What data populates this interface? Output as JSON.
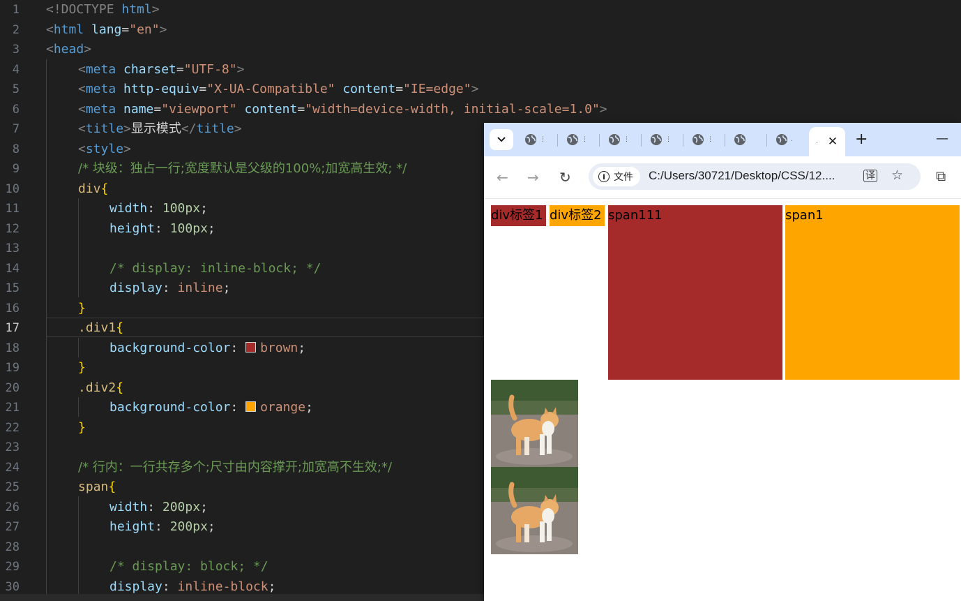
{
  "editor": {
    "active_line": "17",
    "line_numbers": [
      "1",
      "2",
      "3",
      "4",
      "5",
      "6",
      "7",
      "8",
      "9",
      "10",
      "11",
      "12",
      "13",
      "14",
      "15",
      "16",
      "17",
      "18",
      "19",
      "20",
      "21",
      "22",
      "23",
      "24",
      "25",
      "26",
      "27",
      "28",
      "29",
      "30"
    ],
    "code": {
      "l1a": "<!DOCTYPE",
      "l1b": " html",
      "l1c": ">",
      "l2a": "<",
      "l2b": "html",
      "l2c": " lang",
      "l2d": "=",
      "l2e": "\"en\"",
      "l2f": ">",
      "l3a": "<",
      "l3b": "head",
      "l3c": ">",
      "l4a": "<",
      "l4b": "meta",
      "l4c": " charset",
      "l4d": "=",
      "l4e": "\"UTF-8\"",
      "l4f": ">",
      "l5a": "<",
      "l5b": "meta",
      "l5c": " http-equiv",
      "l5d": "=",
      "l5e": "\"X-UA-Compatible\"",
      "l5f": " content",
      "l5g": "=",
      "l5h": "\"IE=edge\"",
      "l5i": ">",
      "l6a": "<",
      "l6b": "meta",
      "l6c": " name",
      "l6d": "=",
      "l6e": "\"viewport\"",
      "l6f": " content",
      "l6g": "=",
      "l6h": "\"width=device-width, initial-scale=1.0\"",
      "l6i": ">",
      "l7a": "<",
      "l7b": "title",
      "l7c": ">",
      "l7d": "显示模式",
      "l7e": "</",
      "l7f": "title",
      "l7g": ">",
      "l8a": "<",
      "l8b": "style",
      "l8c": ">",
      "l9": "/* 块级：独占一行;宽度默认是父级的100%;加宽高生效; */",
      "l10a": "div",
      "l10b": "{",
      "l11a": "width",
      "l11b": ": ",
      "l11c": "100px",
      "l11d": ";",
      "l12a": "height",
      "l12b": ": ",
      "l12c": "100px",
      "l12d": ";",
      "l14": "/* display: inline-block; */",
      "l15a": "display",
      "l15b": ": ",
      "l15c": "inline",
      "l15d": ";",
      "l16": "}",
      "l17a": ".div1",
      "l17b": "{",
      "l18a": "background-color",
      "l18b": ": ",
      "l18c": "brown",
      "l18d": ";",
      "l19": "}",
      "l20a": ".div2",
      "l20b": "{",
      "l21a": "background-color",
      "l21b": ": ",
      "l21c": "orange",
      "l21d": ";",
      "l22": "}",
      "l24": "/* 行内：一行共存多个;尺寸由内容撑开;加宽高不生效;*/",
      "l25a": "span",
      "l25b": "{",
      "l26a": "width",
      "l26b": ": ",
      "l26c": "200px",
      "l26d": ";",
      "l27a": "height",
      "l27b": ": ",
      "l27c": "200px",
      "l27d": ";",
      "l29": "/* display: block; */",
      "l30a": "display",
      "l30b": ": ",
      "l30c": "inline-block",
      "l30d": ";"
    },
    "swatches": {
      "brown": "#a52a2a",
      "orange": "#ffa500"
    }
  },
  "browser": {
    "tabs": [
      {
        "icon": "globe-icon",
        "label": "⋮"
      },
      {
        "icon": "globe-icon",
        "label": "⋮"
      },
      {
        "icon": "globe-icon",
        "label": "⋮"
      },
      {
        "icon": "globe-icon",
        "label": "⋮"
      },
      {
        "icon": "globe-icon",
        "label": "⋮"
      },
      {
        "icon": "globe-icon",
        "label": ""
      },
      {
        "icon": "globe-icon",
        "label": "."
      }
    ],
    "active_tab_label": ".",
    "close_glyph": "✕",
    "new_tab_glyph": "+",
    "minimize_glyph": "—",
    "back_glyph": "←",
    "forward_glyph": "→",
    "reload_glyph": "↻",
    "chip_label": "文件",
    "url": "C:/Users/30721/Desktop/CSS/12....",
    "star_glyph": "☆",
    "translate_glyph": "译",
    "extensions_glyph": "⧉"
  },
  "page": {
    "div1": {
      "text": "div标签1",
      "color": "#a52a2a"
    },
    "div2": {
      "text": "div标签2",
      "color": "#ffa500"
    },
    "span1": {
      "text": "span111",
      "color": "#a52a2a"
    },
    "span2": {
      "text": "span1",
      "color": "#ffa500"
    },
    "images": [
      "cat-photo",
      "cat-photo"
    ]
  }
}
